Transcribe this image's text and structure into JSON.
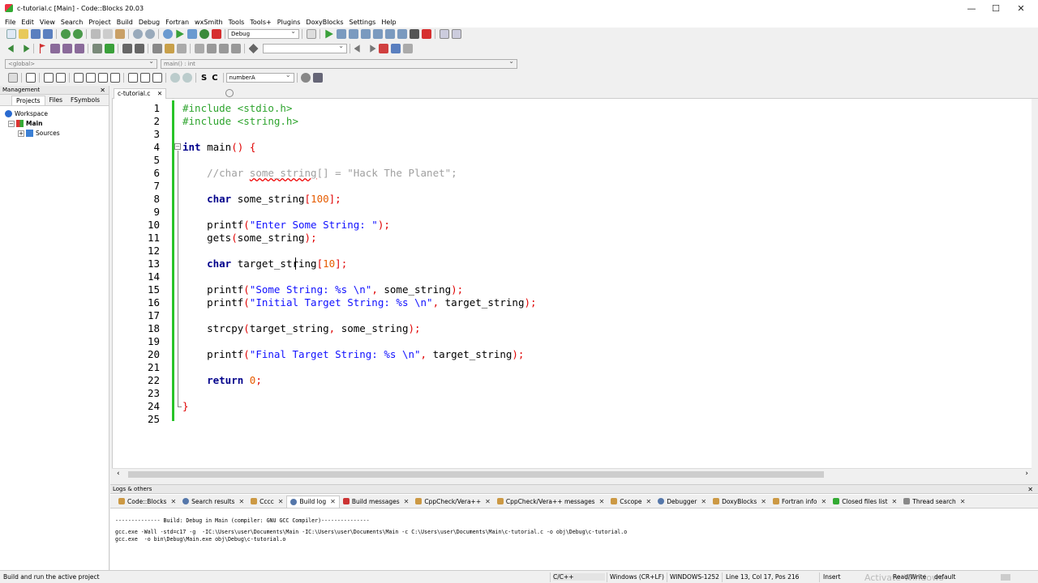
{
  "window": {
    "title": "c-tutorial.c [Main] - Code::Blocks 20.03",
    "minimize": "—",
    "maximize": "☐",
    "close": "✕"
  },
  "menu": [
    "File",
    "Edit",
    "View",
    "Search",
    "Project",
    "Build",
    "Debug",
    "Fortran",
    "wxSmith",
    "Tools",
    "Tools+",
    "Plugins",
    "DoxyBlocks",
    "Settings",
    "Help"
  ],
  "toolbar": {
    "build_target": "Debug",
    "scope": "<global>",
    "function": "main() : int",
    "search_symbol": "numberA",
    "s_label": "S",
    "c_label": "C"
  },
  "management": {
    "title": "Management",
    "tabs": [
      "Projects",
      "Files",
      "FSymbols"
    ],
    "tree": {
      "workspace": "Workspace",
      "project": "Main",
      "folder": "Sources"
    }
  },
  "editor": {
    "tab_label": "c-tutorial.c",
    "line_numbers": [
      "1",
      "2",
      "3",
      "4",
      "5",
      "6",
      "7",
      "8",
      "9",
      "10",
      "11",
      "12",
      "13",
      "14",
      "15",
      "16",
      "17",
      "18",
      "19",
      "20",
      "21",
      "22",
      "23",
      "24",
      "25"
    ]
  },
  "logs": {
    "title": "Logs & others",
    "tabs": [
      "Code::Blocks",
      "Search results",
      "Cccc",
      "Build log",
      "Build messages",
      "CppCheck/Vera++",
      "CppCheck/Vera++ messages",
      "Cscope",
      "Debugger",
      "DoxyBlocks",
      "Fortran info",
      "Closed files list",
      "Thread search"
    ],
    "lines": [
      "-------------- Build: Debug in Main (compiler: GNU GCC Compiler)---------------",
      "gcc.exe -Wall -std=c17 -g  -IC:\\Users\\user\\Documents\\Main -IC:\\Users\\user\\Documents\\Main -c C:\\Users\\user\\Documents\\Main\\c-tutorial.c -o obj\\Debug\\c-tutorial.o",
      "gcc.exe  -o bin\\Debug\\Main.exe obj\\Debug\\c-tutorial.o"
    ]
  },
  "status": {
    "hint": "Build and run the active project",
    "language": "C/C++",
    "eol": "Windows (CR+LF)",
    "encoding": "WINDOWS-1252",
    "position": "Line 13, Col 17, Pos 216",
    "mode": "Insert",
    "access": "Read/Write",
    "profile": "default",
    "watermark": "Activate Windows"
  },
  "colors": {
    "keyword": "#00008b",
    "preprocessor": "#2ea42e",
    "string": "#1010ff",
    "comment": "#a0a0a0",
    "number": "#e65c00",
    "change_bar": "#28c428"
  }
}
